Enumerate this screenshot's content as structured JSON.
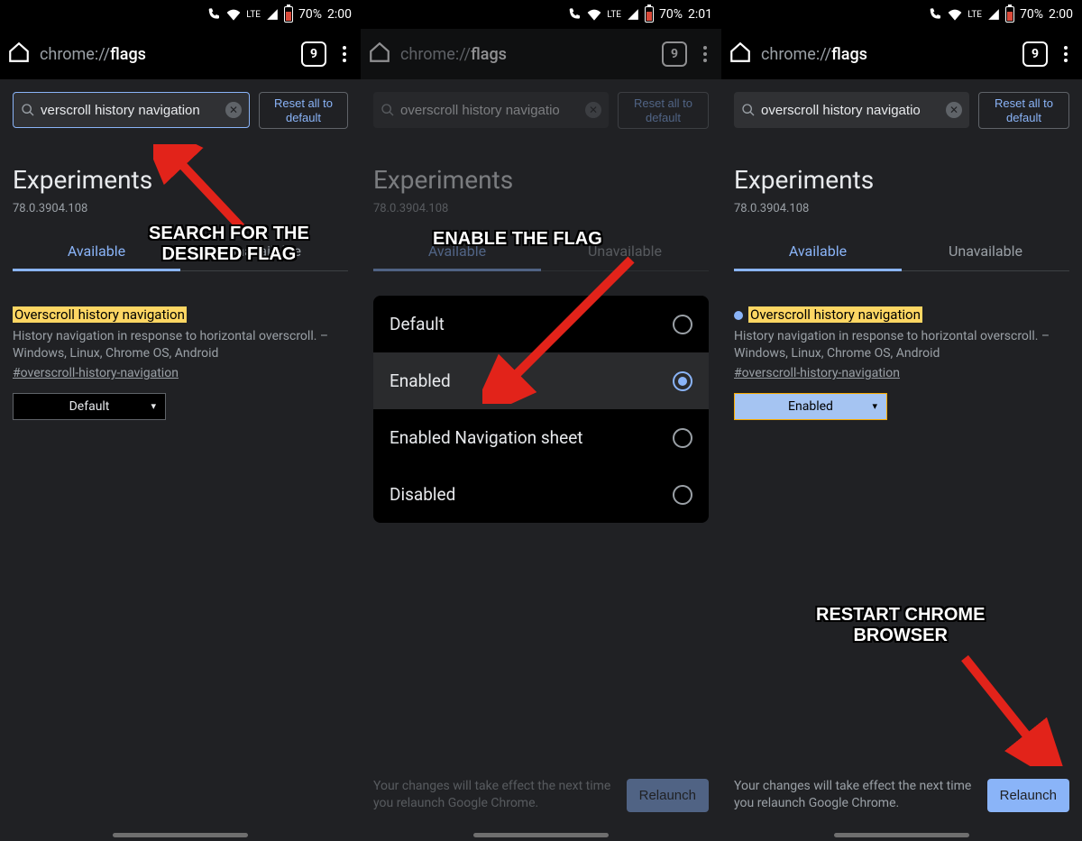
{
  "status": {
    "battery_pct": "70%",
    "time1": "2:00",
    "time2": "2:01",
    "time3": "2:00",
    "lte": "LTE"
  },
  "omnibar": {
    "url_muted": "chrome://",
    "url_bold": "flags",
    "tab_count": "9"
  },
  "search": {
    "value1": "verscroll history navigation",
    "value2": "overscroll history navigatio",
    "value3": "overscroll history navigatio"
  },
  "reset_label": "Reset all to default",
  "page": {
    "heading": "Experiments",
    "version": "78.0.3904.108",
    "tab_available": "Available",
    "tab_unavailable": "Unavailable"
  },
  "flag": {
    "title": "Overscroll history navigation",
    "desc": "History navigation in response to horizontal overscroll. – Windows, Linux, Chrome OS, Android",
    "hash": "#overscroll-history-navigation",
    "select_default": "Default",
    "select_enabled": "Enabled"
  },
  "options": [
    {
      "label": "Default",
      "selected": false
    },
    {
      "label": "Enabled",
      "selected": true
    },
    {
      "label": "Enabled Navigation sheet",
      "selected": false
    },
    {
      "label": "Disabled",
      "selected": false
    }
  ],
  "relaunch": {
    "msg": "Your changes will take effect the next time you relaunch Google Chrome.",
    "btn": "Relaunch"
  },
  "annotations": {
    "a1": "SEARCH FOR THE\nDESIRED FLAG",
    "a2": "ENABLE THE FLAG",
    "a3": "RESTART CHROME\nBROWSER"
  }
}
